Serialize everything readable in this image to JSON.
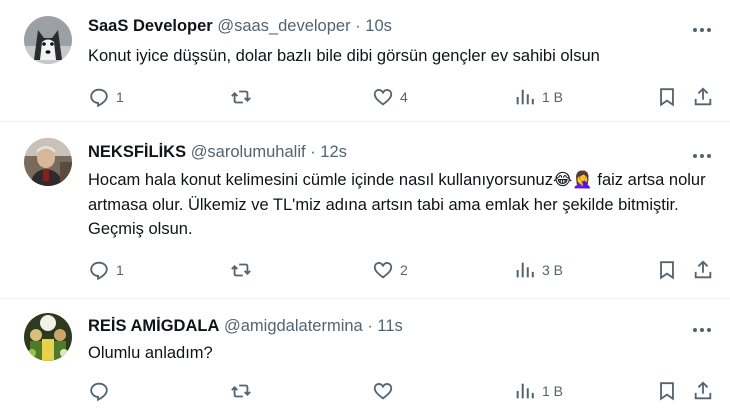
{
  "tweets": [
    {
      "name": "SaaS Developer",
      "handle": "@saas_developer",
      "separator": "·",
      "time": "10s",
      "text": "Konut iyice düşsün, dolar bazlı bile dibi görsün gençler ev sahibi olsun",
      "replies": "1",
      "retweets": "",
      "likes": "4",
      "views": "1 B",
      "avatar": "husky-avatar"
    },
    {
      "name": "NEKSFİLİKS",
      "handle": "@sarolumuhalif",
      "separator": "·",
      "time": "12s",
      "text": "Hocam hala konut kelimesini cümle içinde nasıl kullanıyorsunuz😂🤦‍♀️ faiz artsa nolur artmasa olur. Ülkemiz ve TL'miz adına artsın tabi ama emlak her şekilde bitmiştir. Geçmiş olsun.",
      "replies": "1",
      "retweets": "",
      "likes": "2",
      "views": "3 B",
      "avatar": "man-avatar"
    },
    {
      "name": "REİS AMİGDALA",
      "handle": "@amigdalatermina",
      "separator": "·",
      "time": "11s",
      "text": "Olumlu anladım?",
      "replies": "",
      "retweets": "",
      "likes": "",
      "views": "1 B",
      "avatar": "crowd-avatar"
    }
  ],
  "colors": {
    "text": "#0f1419",
    "muted": "#536471",
    "divider": "#eff3f4"
  },
  "icons": [
    "reply-icon",
    "retweet-icon",
    "like-icon",
    "views-icon",
    "bookmark-icon",
    "share-icon",
    "more-icon"
  ]
}
